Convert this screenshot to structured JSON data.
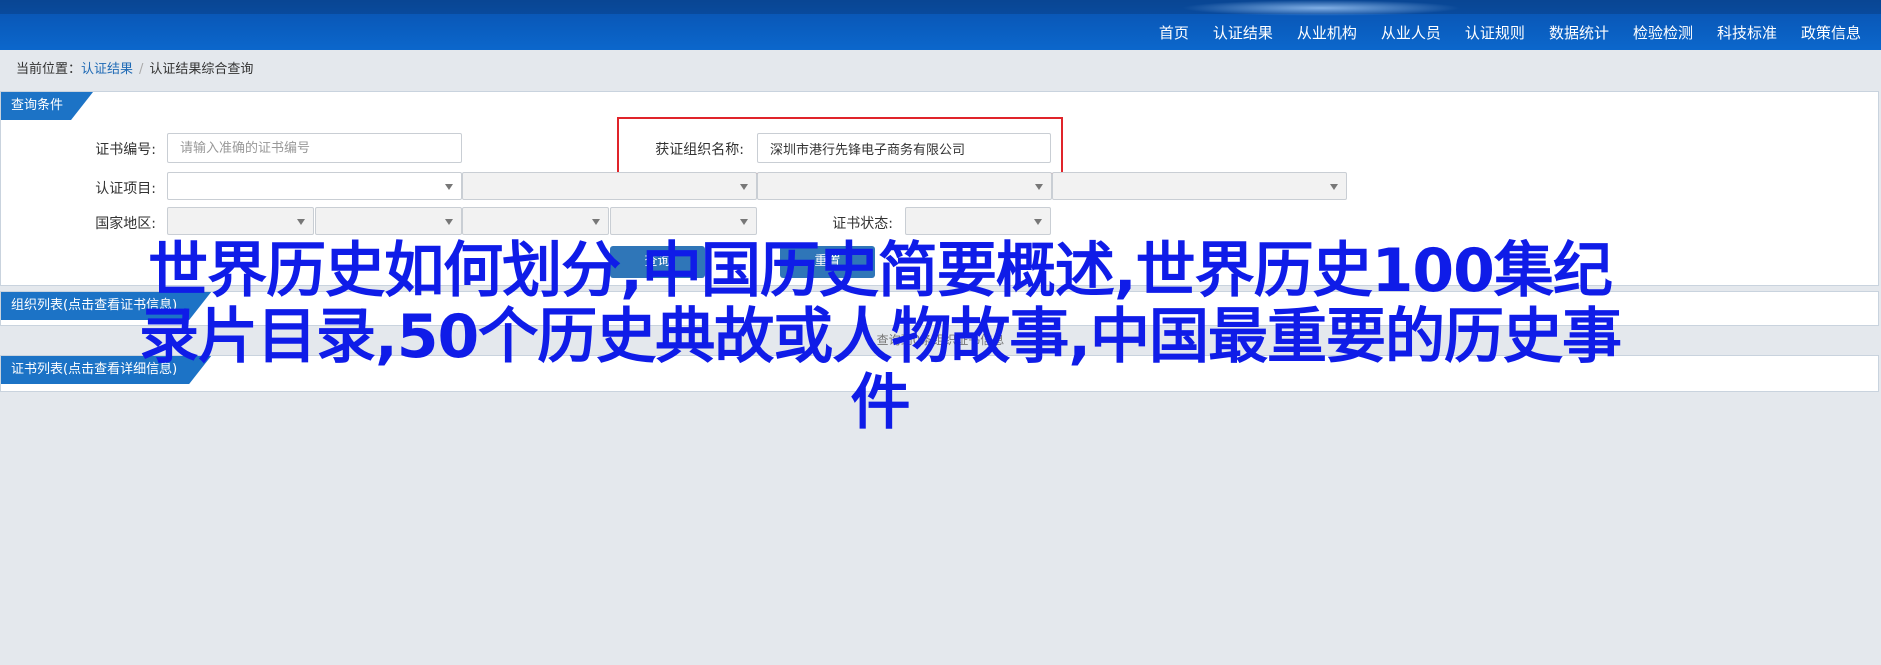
{
  "nav": {
    "items": [
      "首页",
      "认证结果",
      "从业机构",
      "从业人员",
      "认证规则",
      "数据统计",
      "检验检测",
      "科技标准",
      "政策信息"
    ]
  },
  "breadcrumb": {
    "prefix": "当前位置：",
    "link": "认证结果",
    "current": "认证结果综合查询"
  },
  "query": {
    "tab_label": "查询条件",
    "cert_no_label": "证书编号:",
    "cert_no_placeholder": "请输入准确的证书编号",
    "org_label": "获证组织名称:",
    "org_value": "深圳市港行先锋电子商务有限公司",
    "project_label": "认证项目:",
    "region_label": "国家地区:",
    "status_label": "证书状态:",
    "btn_search": "查询",
    "btn_reset": "重置"
  },
  "org_list": {
    "tab_label": "组织列表(点击查看证书信息)",
    "empty_text": "查询到0条组织证书信息"
  },
  "cert_list": {
    "tab_label": "证书列表(点击查看详细信息)"
  },
  "overlay": {
    "line1": "世界历史如何划分,中国历史简要概述,世界历史100集纪",
    "line2": "录片目录,50个历史典故或人物故事,中国最重要的历史事",
    "line3": "件"
  },
  "colors": {
    "nav_bg": "#0b67cc",
    "tab_bg": "#1c73c6",
    "highlight_border": "#e0242a",
    "overlay_text": "#0f1ce8"
  }
}
